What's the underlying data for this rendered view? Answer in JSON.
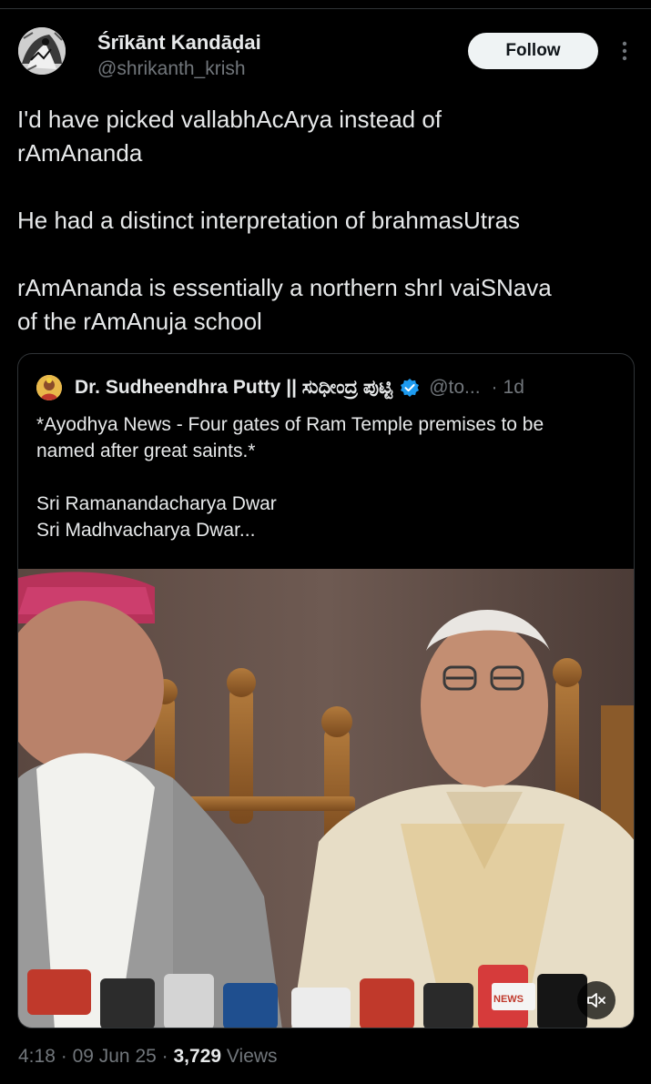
{
  "tweet": {
    "author_name": "Śrīkānt Kandāḍai",
    "author_handle": "@shrikanth_krish",
    "follow_label": "Follow",
    "body": [
      "I'd have picked vallabhAcArya instead of",
      "rAmAnanda",
      "",
      "He had a distinct interpretation of brahmasUtras",
      "",
      "rAmAnanda is essentially a northern shrI vaiSNava",
      "of the rAmAnuja school"
    ],
    "time": "4:18",
    "date": "09 Jun 25",
    "views_count": "3,729",
    "views_label": "Views",
    "separator": "·"
  },
  "quote": {
    "author_name": "Dr. Sudheendhra Putty || ಸುಧೀಂದ್ರ ಪುಟ್ಟಿ",
    "author_handle": "@to...",
    "separator": "·",
    "time": "1d",
    "text": [
      "*Ayodhya News - Four gates of Ram Temple premises to be",
      "named after great saints.*",
      "",
      "Sri Ramanandacharya Dwar",
      "Sri Madhvacharya Dwar..."
    ],
    "video_channel_labels": [
      "NEWS",
      "NEWS"
    ]
  },
  "icons": {
    "more": "more-dots-icon",
    "verified": "verified-badge-icon",
    "mute": "speaker-muted-icon"
  },
  "colors": {
    "background": "#000000",
    "text_primary": "#e7e9ea",
    "text_secondary": "#71767b",
    "border": "#2f3336",
    "follow_bg": "#eff3f4",
    "verified": "#1d9bf0"
  }
}
